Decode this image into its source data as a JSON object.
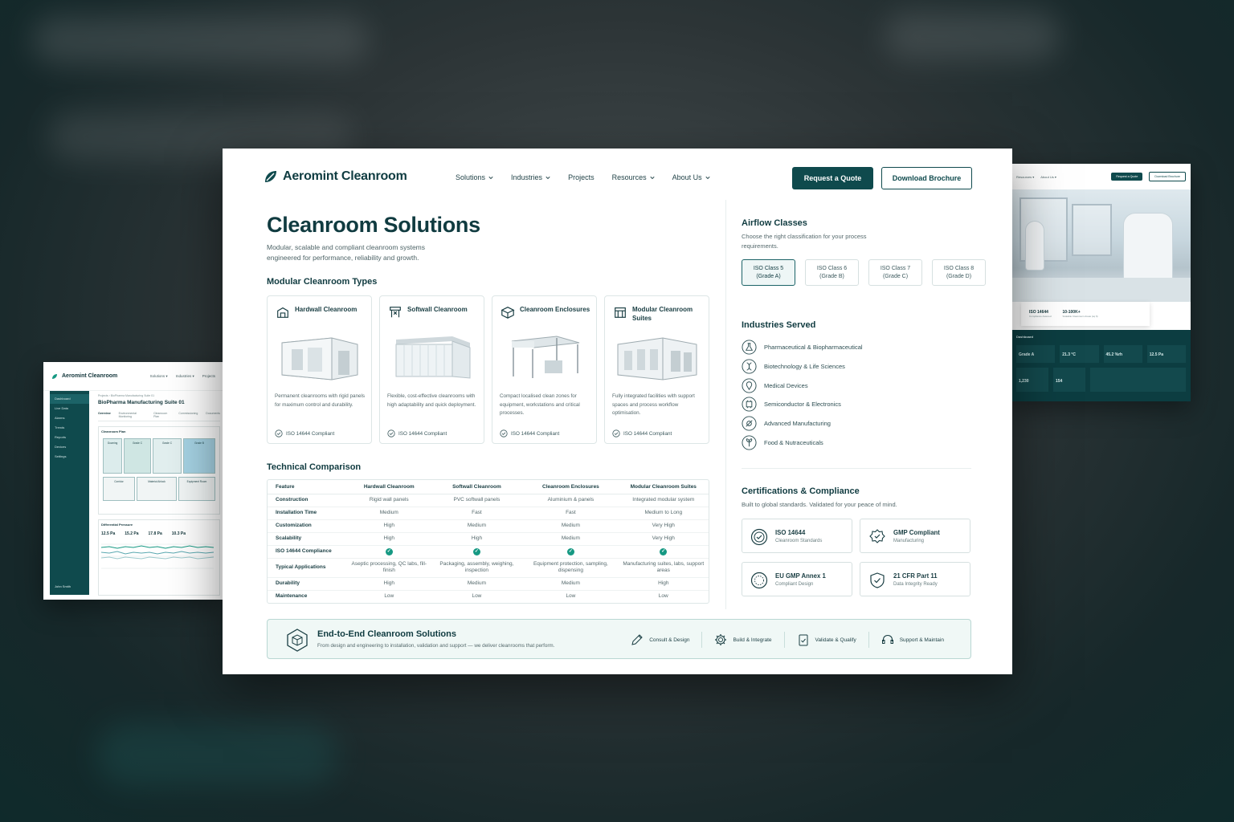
{
  "brand": {
    "name": "Aeromint Cleanroom",
    "accent": "#0f4a4d",
    "teal": "#169983"
  },
  "nav": {
    "items": [
      "Solutions",
      "Industries",
      "Projects",
      "Resources",
      "About Us"
    ],
    "quote_label": "Request a Quote",
    "brochure_label": "Download Brochure"
  },
  "hero": {
    "title": "Cleanroom Solutions",
    "subtitle": "Modular, scalable and compliant cleanroom systems engineered for performance, reliability and growth."
  },
  "types": {
    "title": "Modular Cleanroom Types",
    "cards": [
      {
        "name": "Hardwall Cleanroom",
        "desc": "Permanent cleanrooms with rigid panels for maximum control and durability.",
        "badge": "ISO 14644 Compliant",
        "icon": "hardwall-icon"
      },
      {
        "name": "Softwall Cleanroom",
        "desc": "Flexible, cost-effective cleanrooms with high adaptability and quick deployment.",
        "badge": "ISO 14644 Compliant",
        "icon": "softwall-icon"
      },
      {
        "name": "Cleanroom Enclosures",
        "desc": "Compact localised clean zones for equipment, workstations and critical processes.",
        "badge": "ISO 14644 Compliant",
        "icon": "enclosure-icon"
      },
      {
        "name": "Modular Cleanroom Suites",
        "desc": "Fully integrated facilities with support spaces and process workflow optimisation.",
        "badge": "ISO 14644 Compliant",
        "icon": "suite-icon"
      }
    ]
  },
  "comparison": {
    "title": "Technical Comparison",
    "headers": [
      "Feature",
      "Hardwall Cleanroom",
      "Softwall Cleanroom",
      "Cleanroom Enclosures",
      "Modular Cleanroom Suites"
    ],
    "rows": [
      {
        "f": "Construction",
        "v": [
          "Rigid wall panels",
          "PVC softwall panels",
          "Aluminium & panels",
          "Integrated modular system"
        ]
      },
      {
        "f": "Installation Time",
        "v": [
          "Medium",
          "Fast",
          "Fast",
          "Medium to Long"
        ]
      },
      {
        "f": "Customization",
        "v": [
          "High",
          "Medium",
          "Medium",
          "Very High"
        ]
      },
      {
        "f": "Scalability",
        "v": [
          "High",
          "High",
          "Medium",
          "Very High"
        ]
      },
      {
        "f": "ISO 14644 Compliance",
        "v": [
          "✓",
          "✓",
          "✓",
          "✓"
        ],
        "check": true
      },
      {
        "f": "Typical Applications",
        "v": [
          "Aseptic processing, QC labs, fill-finish",
          "Packaging, assembly, weighing, inspection",
          "Equipment protection, sampling, dispensing",
          "Manufacturing suites, labs, support areas"
        ],
        "tall": true
      },
      {
        "f": "Durability",
        "v": [
          "High",
          "Medium",
          "Medium",
          "High"
        ]
      },
      {
        "f": "Maintenance",
        "v": [
          "Low",
          "Low",
          "Low",
          "Low"
        ]
      }
    ]
  },
  "banner": {
    "title": "End-to-End Cleanroom Solutions",
    "subtitle": "From design and engineering to installation, validation and support — we deliver cleanrooms that perform.",
    "steps": [
      "Consult & Design",
      "Build & Integrate",
      "Validate & Qualify",
      "Support & Maintain"
    ]
  },
  "airflow": {
    "title": "Airflow Classes",
    "subtitle": "Choose the right classification for your process requirements.",
    "classes": [
      {
        "name": "ISO Class 5",
        "grade": "(Grade A)"
      },
      {
        "name": "ISO Class 6",
        "grade": "(Grade B)"
      },
      {
        "name": "ISO Class 7",
        "grade": "(Grade C)"
      },
      {
        "name": "ISO Class 8",
        "grade": "(Grade D)"
      }
    ]
  },
  "industries": {
    "title": "Industries Served",
    "items": [
      "Pharmaceutical & Biopharmaceutical",
      "Biotechnology & Life Sciences",
      "Medical Devices",
      "Semiconductor & Electronics",
      "Advanced Manufacturing",
      "Food & Nutraceuticals"
    ]
  },
  "certs": {
    "title": "Certifications & Compliance",
    "subtitle": "Built to global standards. Validated for your peace of mind.",
    "items": [
      {
        "t": "ISO 14644",
        "s": "Cleanroom Standards"
      },
      {
        "t": "GMP Compliant",
        "s": "Manufacturing"
      },
      {
        "t": "EU GMP Annex 1",
        "s": "Compliant Design"
      },
      {
        "t": "21 CFR Part 11",
        "s": "Data Integrity Ready"
      }
    ]
  },
  "left_preview": {
    "brand": "Aeromint Cleanroom",
    "nav": [
      "Solutions ▾",
      "Industries ▾",
      "Projects"
    ],
    "sidebar": [
      "Dashboard",
      "Live Data",
      "Alarms",
      "Trends",
      "Reports",
      "Devices",
      "Settings"
    ],
    "crumb": "Projects  ›  BioPharma Manufacturing Suite 01",
    "title": "BioPharma Manufacturing Suite 01",
    "tabs": [
      "Overview",
      "Environmental Monitoring",
      "Cleanroom Plan",
      "Commissioning",
      "Documents"
    ],
    "plan_label": "Cleanroom Plan",
    "rooms": [
      "Gowning",
      "Grade C",
      "Grade C",
      "Grade B",
      "Corridor",
      "Material Airlock",
      "Equipment Room"
    ],
    "press_label": "Differential Pressure",
    "press_values": [
      "12.5 Pa",
      "15.2 Pa",
      "17.8 Pa",
      "10.3 Pa"
    ],
    "user": "John Smith"
  },
  "right_preview": {
    "nav": [
      "Resources ▾",
      "About Us ▾"
    ],
    "quote_label": "Request a Quote",
    "brochure_label": "Download Brochure",
    "stat1": "ISO 14644",
    "stat1_sub": "Compliance Assured",
    "stat2": "10-100K+",
    "stat2_sub": "Scalable Cleanroom Areas (sq ft)",
    "dash_title": "Dashboard",
    "kpis": [
      "Grade A",
      "21.3 °C",
      "45.2 %rh",
      "12.5 Pa"
    ],
    "counts": [
      "1,230",
      "154"
    ]
  }
}
